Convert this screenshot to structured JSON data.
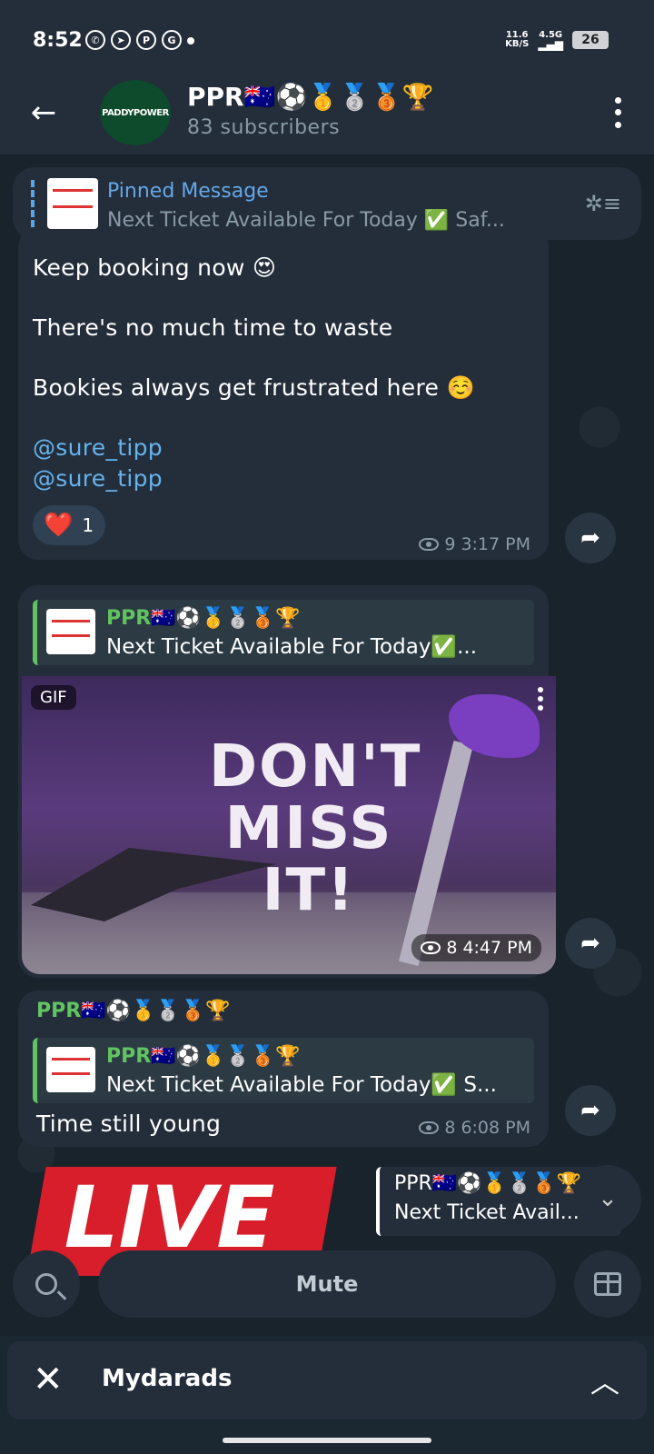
{
  "status_bar": {
    "time": "8:52",
    "net_speed_top": "11.6",
    "net_speed_bottom": "KB/S",
    "network": "4.5G",
    "battery": "26"
  },
  "header": {
    "avatar_text": "PADDYPOWER",
    "title": "PPR🇦🇺⚽🥇🥈🥉🏆",
    "subtitle": "83 subscribers"
  },
  "pinned": {
    "title": "Pinned Message",
    "text": "Next Ticket Available For Today ✅  Saf..."
  },
  "messages": [
    {
      "lines": [
        "Keep booking now 😍",
        "There's no much time to waste",
        "Bookies always get frustrated here ☺️"
      ],
      "links": [
        "@sure_tipp",
        "@sure_tipp"
      ],
      "reaction": {
        "emoji": "❤️",
        "count": "1"
      },
      "views": "9",
      "time": "3:17 PM"
    },
    {
      "reply": {
        "name": "PPR🇦🇺⚽🥇🥈🥉🏆",
        "text": "Next Ticket Available For Today✅..."
      },
      "gif": {
        "badge": "GIF",
        "headline": "DON'T MISS IT!"
      },
      "views": "8",
      "time": "4:47 PM"
    },
    {
      "sender": "PPR🇦🇺⚽🥇🥈🥉🏆",
      "reply": {
        "name": "PPR🇦🇺⚽🥇🥈🥉🏆",
        "text": "Next Ticket Available For Today✅  S..."
      },
      "text": "Time still young",
      "views": "8",
      "time": "6:08 PM"
    }
  ],
  "live_banner": "LIVE",
  "floating_reply": {
    "name": "PPR🇦🇺⚽🥇🥈🥉🏆",
    "text": "Next Ticket Avail..."
  },
  "bottom": {
    "mute_label": "Mute"
  },
  "ad": {
    "label": "Mydarads"
  },
  "colors": {
    "accent": "#64a8e8",
    "green": "#62c461",
    "bubble": "#232e3a",
    "background": "#18232c"
  }
}
